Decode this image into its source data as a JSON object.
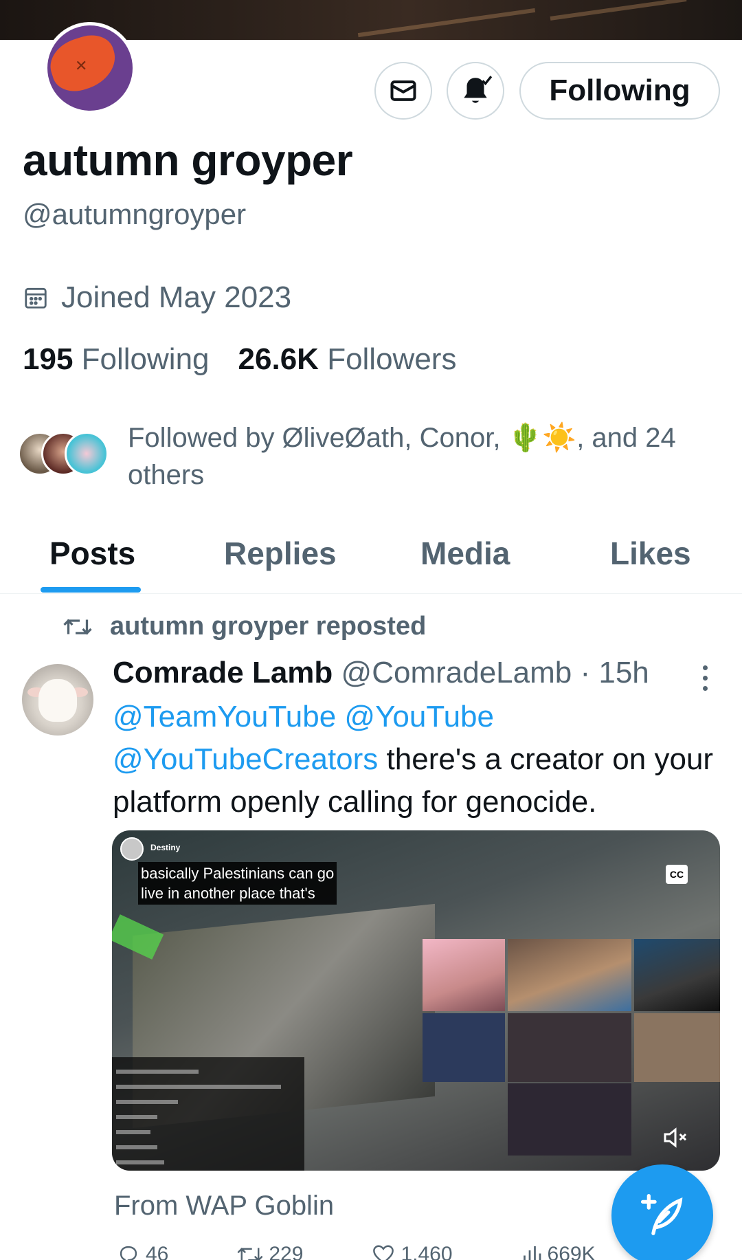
{
  "profile": {
    "display_name": "autumn groyper",
    "handle": "@autumngroyper",
    "joined": "Joined May 2023",
    "following_count": "195",
    "following_label": "Following",
    "followers_count": "26.6K",
    "followers_label": "Followers",
    "followed_by": "Followed by ØliveØath, Conor, 🌵☀️, and 24 others"
  },
  "header_actions": {
    "follow_button_label": "Following",
    "message_icon": "envelope-icon",
    "notification_icon": "bell-check-icon"
  },
  "tabs": [
    {
      "label": "Posts",
      "active": true
    },
    {
      "label": "Replies",
      "active": false
    },
    {
      "label": "Media",
      "active": false
    },
    {
      "label": "Likes",
      "active": false
    }
  ],
  "post": {
    "repost_label": "autumn groyper reposted",
    "author_name": "Comrade Lamb",
    "author_handle": "@ComradeLamb",
    "separator": "·",
    "time": "15h",
    "text_mentions": [
      "@TeamYouTube",
      "@YouTube",
      "@YouTubeCreators"
    ],
    "text_body": "there's a creator on your platform openly calling for genocide.",
    "media": {
      "caption_line1": "basically Palestinians can go",
      "caption_line2": "live in another place that's",
      "cc_label": "CC",
      "channel_name": "Destiny"
    },
    "source": "From WAP Goblin",
    "actions": {
      "replies": "46",
      "reposts": "229",
      "likes": "1,460",
      "views": "669K"
    }
  },
  "colors": {
    "accent": "#1d9bf0",
    "text_primary": "#0f1419",
    "text_secondary": "#536471",
    "border": "#cfd9de"
  }
}
